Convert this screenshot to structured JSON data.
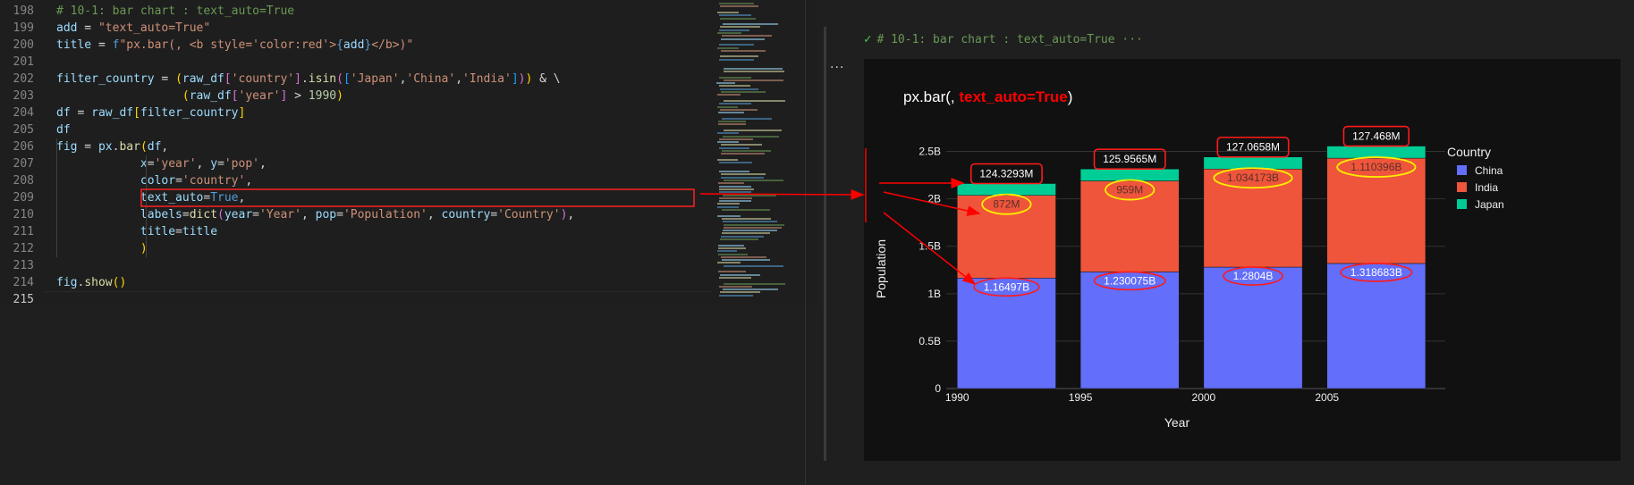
{
  "editor": {
    "line_numbers": [
      "198",
      "199",
      "200",
      "201",
      "202",
      "203",
      "204",
      "205",
      "206",
      "207",
      "208",
      "209",
      "210",
      "211",
      "212",
      "213",
      "214",
      "215"
    ],
    "lines": [
      [
        [
          "comment",
          "# 10-1: bar chart : text_auto=True"
        ]
      ],
      [
        [
          "var",
          "add"
        ],
        [
          "op",
          " = "
        ],
        [
          "str",
          "\"text_auto=True\""
        ]
      ],
      [
        [
          "var",
          "title"
        ],
        [
          "op",
          " = "
        ],
        [
          "kw",
          "f"
        ],
        [
          "str",
          "\"px.bar(, <b style='color:red'>"
        ],
        [
          "kw",
          "{"
        ],
        [
          "var",
          "add"
        ],
        [
          "kw",
          "}"
        ],
        [
          "str",
          "</b>)\""
        ]
      ],
      [],
      [
        [
          "var",
          "filter_country"
        ],
        [
          "op",
          " = "
        ],
        [
          "brk",
          "("
        ],
        [
          "var",
          "raw_df"
        ],
        [
          "brk2",
          "["
        ],
        [
          "str",
          "'country'"
        ],
        [
          "brk2",
          "]"
        ],
        [
          "op",
          "."
        ],
        [
          "fn",
          "isin"
        ],
        [
          "brk2",
          "("
        ],
        [
          "brk3",
          "["
        ],
        [
          "str",
          "'Japan'"
        ],
        [
          "op",
          ","
        ],
        [
          "str",
          "'China'"
        ],
        [
          "op",
          ","
        ],
        [
          "str",
          "'India'"
        ],
        [
          "brk3",
          "]"
        ],
        [
          "brk2",
          ")"
        ],
        [
          "brk",
          ")"
        ],
        [
          "op",
          " & \\"
        ]
      ],
      [
        [
          "op",
          "                  "
        ],
        [
          "brk",
          "("
        ],
        [
          "var",
          "raw_df"
        ],
        [
          "brk2",
          "["
        ],
        [
          "str",
          "'year'"
        ],
        [
          "brk2",
          "]"
        ],
        [
          "op",
          " > "
        ],
        [
          "num",
          "1990"
        ],
        [
          "brk",
          ")"
        ]
      ],
      [
        [
          "var",
          "df"
        ],
        [
          "op",
          " = "
        ],
        [
          "var",
          "raw_df"
        ],
        [
          "brk",
          "["
        ],
        [
          "var",
          "filter_country"
        ],
        [
          "brk",
          "]"
        ]
      ],
      [
        [
          "var",
          "df"
        ]
      ],
      [
        [
          "var",
          "fig"
        ],
        [
          "op",
          " = "
        ],
        [
          "var",
          "px"
        ],
        [
          "op",
          "."
        ],
        [
          "fn",
          "bar"
        ],
        [
          "brk",
          "("
        ],
        [
          "var",
          "df"
        ],
        [
          "op",
          ","
        ]
      ],
      [
        [
          "op",
          "            "
        ],
        [
          "var",
          "x"
        ],
        [
          "op",
          "="
        ],
        [
          "str",
          "'year'"
        ],
        [
          "op",
          ", "
        ],
        [
          "var",
          "y"
        ],
        [
          "op",
          "="
        ],
        [
          "str",
          "'pop'"
        ],
        [
          "op",
          ","
        ]
      ],
      [
        [
          "op",
          "            "
        ],
        [
          "var",
          "color"
        ],
        [
          "op",
          "="
        ],
        [
          "str",
          "'country'"
        ],
        [
          "op",
          ","
        ]
      ],
      [
        [
          "op",
          "            "
        ],
        [
          "var",
          "text_auto"
        ],
        [
          "op",
          "="
        ],
        [
          "kw",
          "True"
        ],
        [
          "op",
          ","
        ]
      ],
      [
        [
          "op",
          "            "
        ],
        [
          "var",
          "labels"
        ],
        [
          "op",
          "="
        ],
        [
          "fn",
          "dict"
        ],
        [
          "brk2",
          "("
        ],
        [
          "var",
          "year"
        ],
        [
          "op",
          "="
        ],
        [
          "str",
          "'Year'"
        ],
        [
          "op",
          ", "
        ],
        [
          "var",
          "pop"
        ],
        [
          "op",
          "="
        ],
        [
          "str",
          "'Population'"
        ],
        [
          "op",
          ", "
        ],
        [
          "var",
          "country"
        ],
        [
          "op",
          "="
        ],
        [
          "str",
          "'Country'"
        ],
        [
          "brk2",
          ")"
        ],
        [
          "op",
          ","
        ]
      ],
      [
        [
          "op",
          "            "
        ],
        [
          "var",
          "title"
        ],
        [
          "op",
          "="
        ],
        [
          "var",
          "title"
        ]
      ],
      [
        [
          "op",
          "            "
        ],
        [
          "brk",
          ")"
        ]
      ],
      [],
      [
        [
          "var",
          "fig"
        ],
        [
          "op",
          "."
        ],
        [
          "fn",
          "show"
        ],
        [
          "brk",
          "("
        ],
        [
          "brk",
          ")"
        ]
      ],
      []
    ]
  },
  "output_cell": {
    "header": "# 10-1: bar chart : text_auto=True ···",
    "more": "..."
  },
  "chart_data": {
    "type": "bar",
    "stacked": true,
    "title_plain": "px.bar(, ",
    "title_bold": "text_auto=True",
    "title_close": ")",
    "xlabel": "Year",
    "ylabel": "Population",
    "x_ticks": [
      "1990",
      "1995",
      "2000",
      "2005"
    ],
    "y_ticks": [
      {
        "value": 0,
        "label": "0"
      },
      {
        "value": 0.5,
        "label": "0.5B"
      },
      {
        "value": 1,
        "label": "1B"
      },
      {
        "value": 1.5,
        "label": "1.5B"
      },
      {
        "value": 2,
        "label": "2B"
      },
      {
        "value": 2.5,
        "label": "2.5B"
      }
    ],
    "ylim": [
      0,
      2.75
    ],
    "legend_title": "Country",
    "legend_position": "top-right",
    "categories": [
      "1992",
      "1997",
      "2002",
      "2007"
    ],
    "series": [
      {
        "name": "China",
        "color": "#636efa",
        "values": [
          1.16497,
          1.230075,
          1.2804,
          1.318683
        ],
        "labels": [
          "1.16497B",
          "1.230075B",
          "1.2804B",
          "1.318683B"
        ]
      },
      {
        "name": "India",
        "color": "#ef553b",
        "values": [
          0.872,
          0.959,
          1.034173,
          1.110396
        ],
        "labels": [
          "872M",
          "959M",
          "1.034173B",
          "1.110396B"
        ]
      },
      {
        "name": "Japan",
        "color": "#00cc96",
        "values": [
          0.1243293,
          0.1259565,
          0.1270658,
          0.127468
        ],
        "labels": [
          "124.3293M",
          "125.9565M",
          "127.0658M",
          "127.468M"
        ]
      }
    ]
  }
}
